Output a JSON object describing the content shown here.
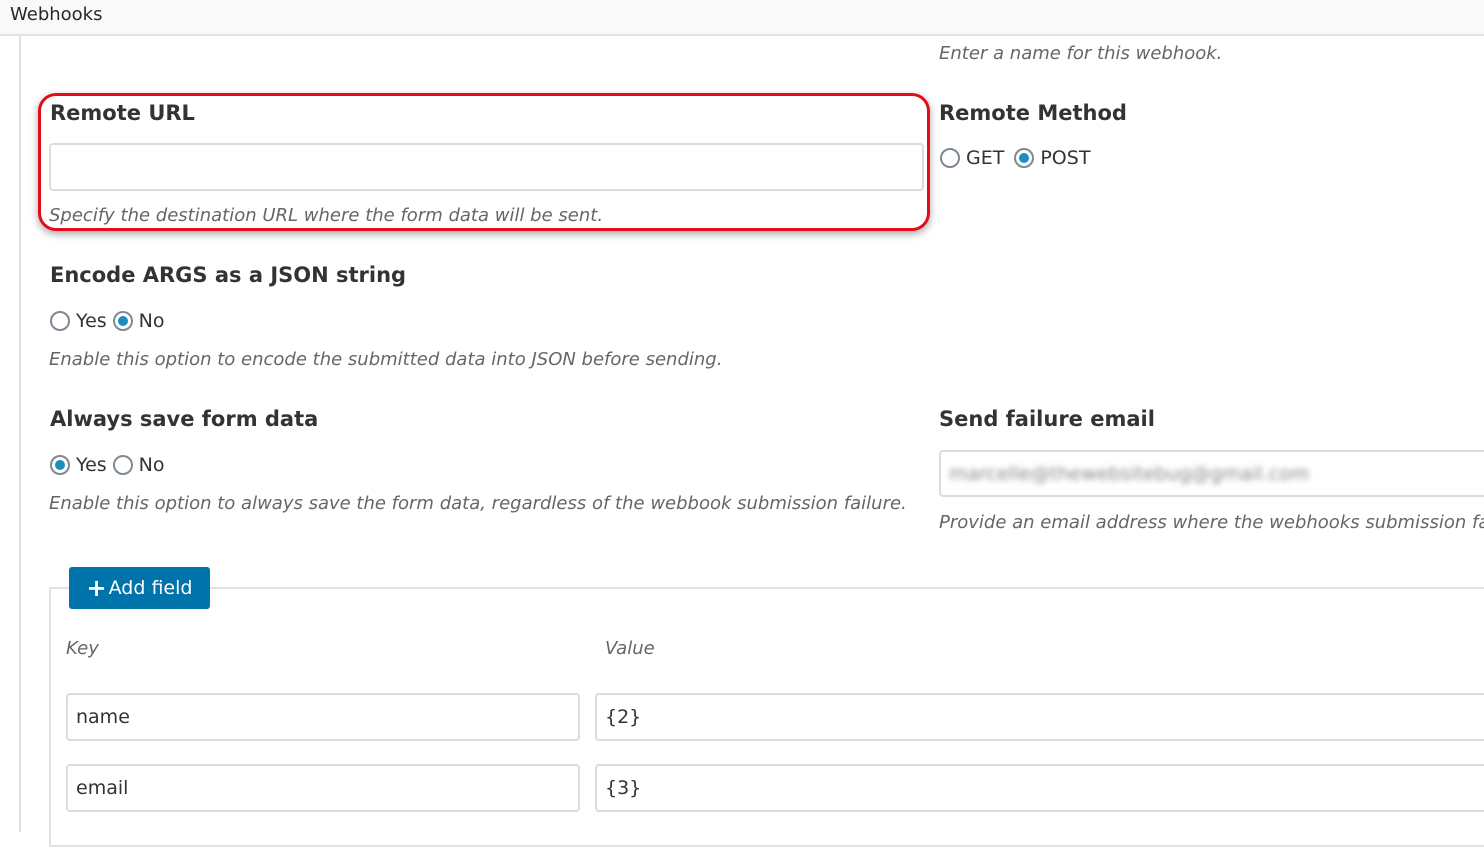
{
  "header": {
    "title": "Webhooks"
  },
  "name_field": {
    "description": "Enter a name for this webhook."
  },
  "remote_url": {
    "label": "Remote URL",
    "value": "",
    "description": "Specify the destination URL where the form data will be sent."
  },
  "remote_method": {
    "label": "Remote Method",
    "options": [
      {
        "label": "GET",
        "checked": false
      },
      {
        "label": "POST",
        "checked": true
      }
    ]
  },
  "encode_json": {
    "label": "Encode ARGS as a JSON string",
    "options": [
      {
        "label": "Yes",
        "checked": false
      },
      {
        "label": "No",
        "checked": true
      }
    ],
    "description": "Enable this option to encode the submitted data into JSON before sending."
  },
  "always_save": {
    "label": "Always save form data",
    "options": [
      {
        "label": "Yes",
        "checked": true
      },
      {
        "label": "No",
        "checked": false
      }
    ],
    "description": "Enable this option to always save the form data, regardless of the webbook submission failure."
  },
  "failure_email": {
    "label": "Send failure email",
    "value": "marcelle@thewebsitebug@gmail.com",
    "description": "Provide an email address where the webhooks submission failure"
  },
  "fields": {
    "add_button": "Add field",
    "key_header": "Key",
    "value_header": "Value",
    "rows": [
      {
        "key": "name",
        "value": "{2}"
      },
      {
        "key": "email",
        "value": "{3}"
      }
    ]
  },
  "colors": {
    "accent": "#0073aa",
    "highlight": "#e30d1a",
    "radio_checked": "#1e8cbe"
  }
}
